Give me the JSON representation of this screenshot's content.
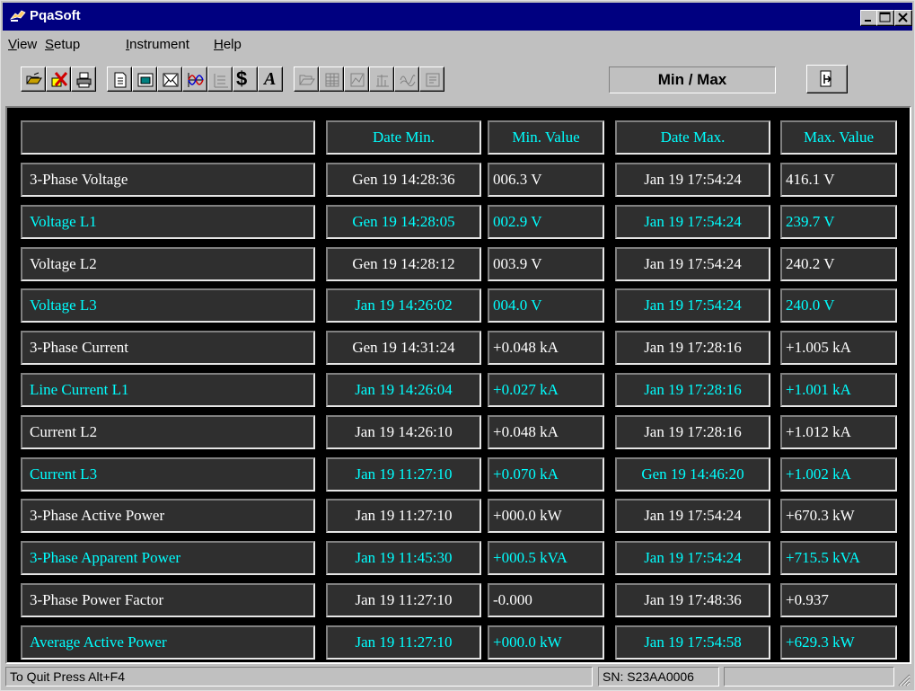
{
  "window": {
    "title": "PqaSoft",
    "controls": {
      "minimize": "_",
      "maximize": "□",
      "close": "×"
    }
  },
  "menu": [
    {
      "label": "View",
      "accel": "V",
      "rest": "iew"
    },
    {
      "label": "Setup",
      "accel": "S",
      "rest": "etup"
    },
    {
      "label": "Instrument",
      "accel": "I",
      "rest": "nstrument"
    },
    {
      "label": "Help",
      "accel": "H",
      "rest": "elp"
    }
  ],
  "toolbar": {
    "mode_label": "Min / Max",
    "icons": [
      "open-icon",
      "delete-icon",
      "print-icon",
      "page-icon",
      "window-icon",
      "envelope-icon",
      "waveform-icon",
      "harmonics-icon",
      "dollar-icon",
      "font-icon",
      "folder-icon",
      "grid-icon",
      "chart-icon",
      "bars-icon",
      "scope-icon",
      "report-icon",
      "exit-icon"
    ],
    "dollar_glyph": "$",
    "font_glyph": "A"
  },
  "table": {
    "headers": [
      "",
      "Date Min.",
      "Min. Value",
      "Date Max.",
      "Max. Value"
    ],
    "rows": [
      {
        "name": "3-Phase Voltage",
        "date_min": "Gen 19 14:28:36",
        "min_value": "006.3  V",
        "date_max": "Jan 19 17:54:24",
        "max_value": "416.1  V",
        "color": "white"
      },
      {
        "name": "Voltage L1",
        "date_min": "Gen 19 14:28:05",
        "min_value": "002.9  V",
        "date_max": "Jan 19 17:54:24",
        "max_value": "239.7  V",
        "color": "cyan"
      },
      {
        "name": "Voltage L2",
        "date_min": "Gen 19 14:28:12",
        "min_value": "003.9  V",
        "date_max": "Jan 19 17:54:24",
        "max_value": "240.2  V",
        "color": "white"
      },
      {
        "name": "Voltage L3",
        "date_min": "Jan 19 14:26:02",
        "min_value": "004.0  V",
        "date_max": "Jan 19 17:54:24",
        "max_value": "240.0  V",
        "color": "cyan"
      },
      {
        "name": "3-Phase Current",
        "date_min": "Gen 19 14:31:24",
        "min_value": "+0.048 kA",
        "date_max": "Jan 19 17:28:16",
        "max_value": "+1.005 kA",
        "color": "white"
      },
      {
        "name": "Line Current L1",
        "date_min": "Jan 19 14:26:04",
        "min_value": "+0.027 kA",
        "date_max": "Jan 19 17:28:16",
        "max_value": "+1.001 kA",
        "color": "cyan"
      },
      {
        "name": "Current L2",
        "date_min": "Jan 19 14:26:10",
        "min_value": "+0.048 kA",
        "date_max": "Jan 19 17:28:16",
        "max_value": "+1.012 kA",
        "color": "white"
      },
      {
        "name": "Current L3",
        "date_min": "Jan 19 11:27:10",
        "min_value": "+0.070 kA",
        "date_max": "Gen 19 14:46:20",
        "max_value": "+1.002 kA",
        "color": "cyan"
      },
      {
        "name": "3-Phase Active Power",
        "date_min": "Jan 19 11:27:10",
        "min_value": "+000.0 kW",
        "date_max": "Jan 19 17:54:24",
        "max_value": "+670.3 kW",
        "color": "white"
      },
      {
        "name": "3-Phase Apparent Power",
        "date_min": "Jan 19 11:45:30",
        "min_value": "+000.5 kVA",
        "date_max": "Jan 19 17:54:24",
        "max_value": "+715.5 kVA",
        "color": "cyan"
      },
      {
        "name": "3-Phase Power Factor",
        "date_min": "Jan 19 11:27:10",
        "min_value": "-0.000",
        "date_max": "Jan 19 17:48:36",
        "max_value": "+0.937",
        "color": "white"
      },
      {
        "name": "Average Active Power",
        "date_min": "Jan 19 11:27:10",
        "min_value": "+000.0 kW",
        "date_max": "Jan 19 17:54:58",
        "max_value": "+629.3 kW",
        "color": "cyan"
      }
    ]
  },
  "status": {
    "hint": "To Quit Press Alt+F4",
    "serial": "SN: S23AA0006"
  },
  "colors": {
    "titlebar": "#000080",
    "panel": "#2f2f2f",
    "text_white": "#ffffff",
    "text_cyan": "#00ffff",
    "chrome": "#c0c0c0"
  }
}
